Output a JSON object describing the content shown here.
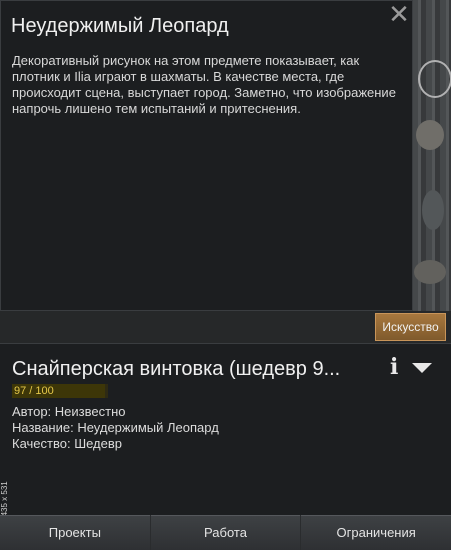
{
  "art_window": {
    "title": "Неудержимый Леопард",
    "description": "Декоративный рисунок на этом предмете показывает, как плотник и Ilia играют в шахматы. В качестве места, где происходит сцена, выступает город. Заметно, что изображение напрочь лишено тем испытаний и притеснения.",
    "close_icon": "close-icon"
  },
  "art_tab": {
    "label": "Искусство"
  },
  "item_panel": {
    "title": "Снайперская винтовка (шедевр 9...",
    "quality": {
      "text": "97 / 100",
      "fraction": 0.97
    },
    "author_line": "Автор: Неизвестно",
    "name_line": "Название: Неудержимый Леопард",
    "quality_line": "Качество: Шедевр",
    "info_icon": "info-icon",
    "dropdown_icon": "dropdown-triangle-icon"
  },
  "side_text": "37.62 К6 435 x 531",
  "bottom_tabs": [
    {
      "label": "Проекты"
    },
    {
      "label": "Работа"
    },
    {
      "label": "Ограничения"
    }
  ],
  "colors": {
    "art_tab": "#9a6d36",
    "quality_text": "#e6c84a",
    "panel_bg": "#1c1e20"
  }
}
